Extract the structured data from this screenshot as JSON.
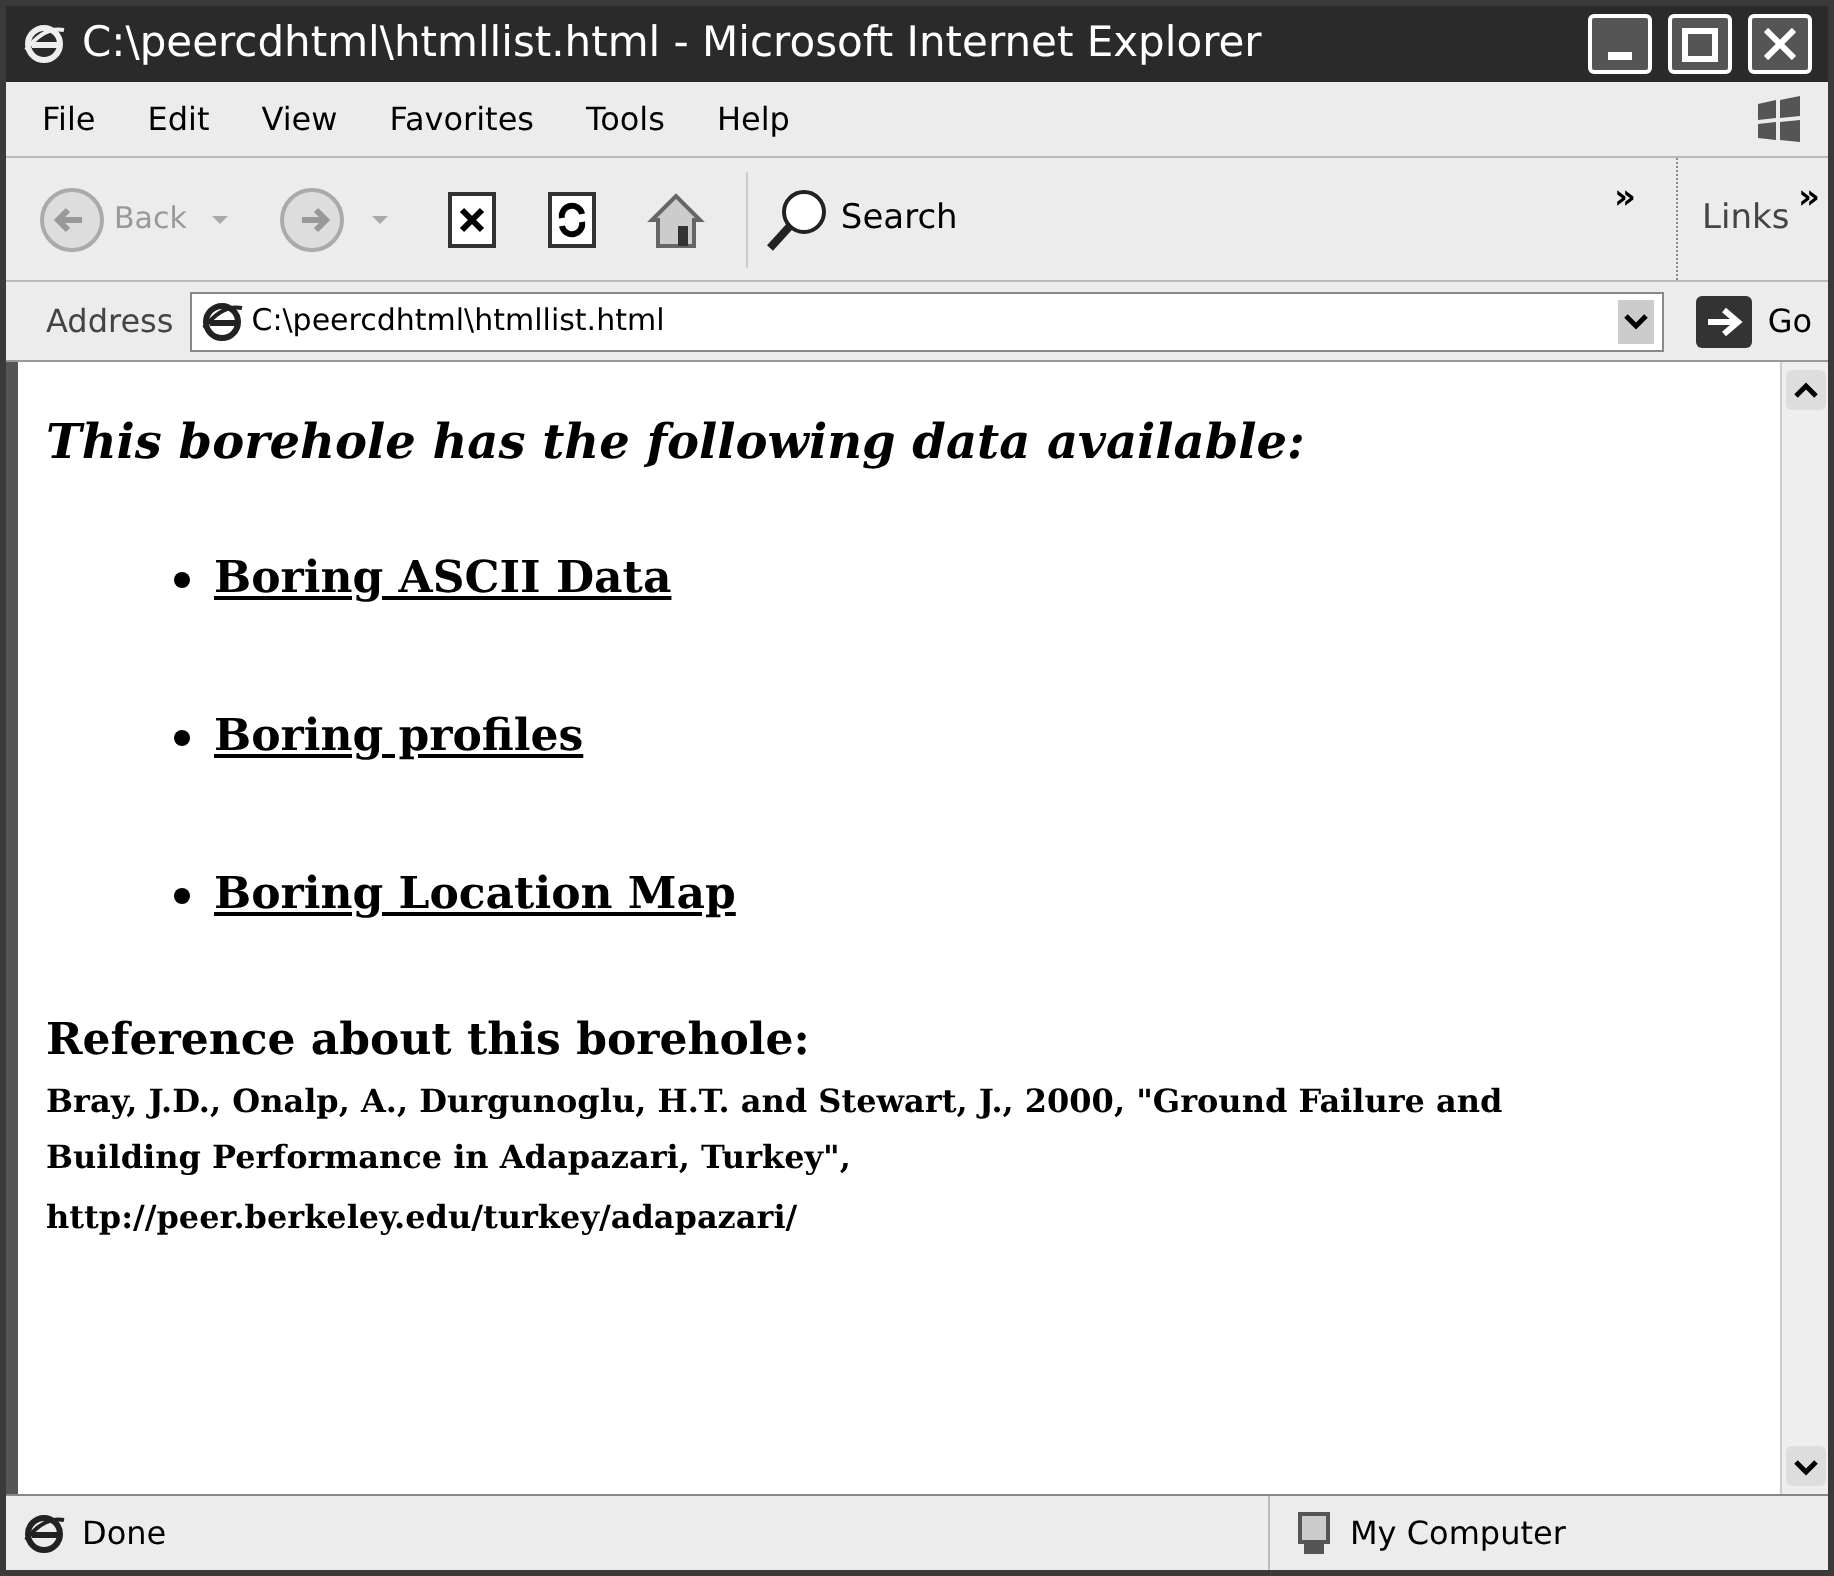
{
  "window": {
    "title": "C:\\peercdhtml\\htmllist.html - Microsoft Internet Explorer"
  },
  "menu": [
    "File",
    "Edit",
    "View",
    "Favorites",
    "Tools",
    "Help"
  ],
  "toolbar": {
    "back": {
      "label": "Back",
      "disabled": true
    },
    "search": {
      "label": "Search"
    },
    "more": "»",
    "links": "Links",
    "links_more": "»"
  },
  "address_bar": {
    "label": "Address",
    "value": "C:\\peercdhtml\\htmllist.html",
    "go": "Go"
  },
  "page": {
    "heading": "This borehole has the following data available:",
    "links": [
      "Boring ASCII Data",
      "Boring profiles",
      "Boring Location Map"
    ],
    "reference_heading": "Reference about this borehole:",
    "reference": "Bray, J.D., Onalp, A., Durgunoglu, H.T. and Stewart, J., 2000, \"Ground Failure and Building Performance in Adapazari, Turkey\",",
    "url": "http://peer.berkeley.edu/turkey/adapazari/"
  },
  "status_bar": {
    "text": "Done",
    "zone": "My Computer"
  }
}
